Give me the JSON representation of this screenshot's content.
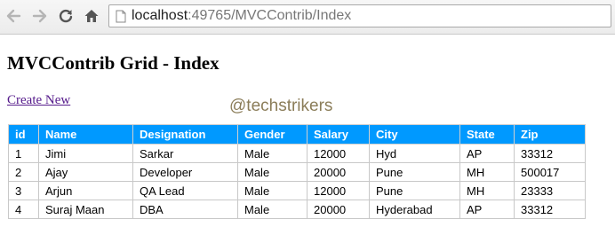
{
  "browser": {
    "url_host": "localhost",
    "url_path": ":49765/MVCContrib/Index"
  },
  "page": {
    "title": "MVCContrib Grid - Index",
    "create_link": "Create New",
    "watermark": "@techstrikers"
  },
  "table": {
    "columns": [
      "id",
      "Name",
      "Designation",
      "Gender",
      "Salary",
      "City",
      "State",
      "Zip"
    ],
    "rows": [
      [
        "1",
        "Jimi",
        "Sarkar",
        "Male",
        "12000",
        "Hyd",
        "AP",
        "33312"
      ],
      [
        "2",
        "Ajay",
        "Developer",
        "Male",
        "20000",
        "Pune",
        "MH",
        "500017"
      ],
      [
        "3",
        "Arjun",
        "QA Lead",
        "Male",
        "12000",
        "Pune",
        "MH",
        "23333"
      ],
      [
        "4",
        "Suraj Maan",
        "DBA",
        "Male",
        "20000",
        "Hyderabad",
        "AP",
        "33312"
      ]
    ]
  },
  "colors": {
    "header_bg": "#0099ff",
    "link": "#551a8b",
    "watermark": "#8b7d59"
  },
  "icons": [
    "back-arrow-icon",
    "forward-arrow-icon",
    "reload-icon",
    "home-icon",
    "page-icon"
  ]
}
